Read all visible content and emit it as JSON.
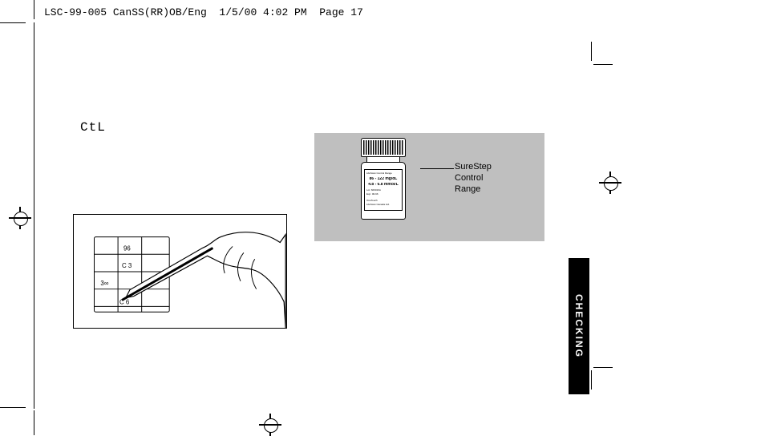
{
  "header": {
    "slug": "LSC-99-005 CanSS(RR)OB/Eng  1/5/00 4:02 PM  Page 17"
  },
  "display_label": "CtL",
  "bottle": {
    "callout_line1": "SureStep",
    "callout_line2": "Control",
    "callout_line3": "Range",
    "label_title": "LifeScan Control Range",
    "label_line1": "86 - 122 mg/dL",
    "label_line2": "4.8 - 6.8 mmol/L",
    "label_lot": "Lot:  606016A",
    "label_exp": "Exp:  06-96",
    "label_brand": "OneTouch",
    "label_fine": "LifeScan Canada Ltd."
  },
  "hand_panel": {
    "alt": "Hand writing control solution result in a log book with a pen"
  },
  "section_tab": "CHECKING"
}
